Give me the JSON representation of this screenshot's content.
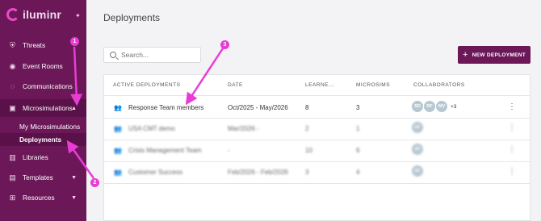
{
  "app": {
    "logo_text": "iluminr"
  },
  "sidebar": {
    "items": [
      {
        "label": "Threats",
        "icon": "shield-icon",
        "glyph": "⛨"
      },
      {
        "label": "Event Rooms",
        "icon": "event-room-icon",
        "glyph": "◉"
      },
      {
        "label": "Communications",
        "icon": "chat-icon",
        "glyph": "◌"
      },
      {
        "label": "Microsimulations",
        "icon": "briefcase-icon",
        "glyph": "▣"
      }
    ],
    "sub_items": [
      {
        "label": "My Microsimulations"
      },
      {
        "label": "Deployments"
      }
    ],
    "lower_items": [
      {
        "label": "Libraries",
        "icon": "book-icon",
        "glyph": "▥"
      },
      {
        "label": "Templates",
        "icon": "template-icon",
        "glyph": "▤"
      },
      {
        "label": "Resources",
        "icon": "grid-icon",
        "glyph": "⊞"
      }
    ]
  },
  "main": {
    "title": "Deployments",
    "search_placeholder": "Search...",
    "new_button_label": "NEW DEPLOYMENT"
  },
  "table": {
    "columns": [
      "ACTIVE DEPLOYMENTS",
      "DATE",
      "LEARNE...",
      "MICROSIMS",
      "COLLABORATORS"
    ],
    "rows": [
      {
        "name": "Response Team members",
        "date": "Oct/2025 - May/2026",
        "learners": "8",
        "microsims": "3",
        "collaborators": [
          "SD",
          "RF",
          "MV"
        ],
        "more": "+3",
        "blurred": false
      },
      {
        "name": "USA CMT demo",
        "date": "Mar/2026 -",
        "learners": "2",
        "microsims": "1",
        "collaborators": [
          "AF"
        ],
        "more": "",
        "blurred": true
      },
      {
        "name": "Crisis Management Team",
        "date": "-",
        "learners": "10",
        "microsims": "6",
        "collaborators": [
          "AF"
        ],
        "more": "",
        "blurred": true
      },
      {
        "name": "Customer Success",
        "date": "Feb/2026 - Feb/2026",
        "learners": "3",
        "microsims": "4",
        "collaborators": [
          "AF"
        ],
        "more": "",
        "blurred": true
      }
    ]
  },
  "annotations": {
    "badges": [
      "1",
      "2",
      "3"
    ],
    "color": "#e83cd5"
  },
  "colors": {
    "sidebar": "#6b1758",
    "accent": "#e83cd5",
    "button": "#6b1758"
  }
}
